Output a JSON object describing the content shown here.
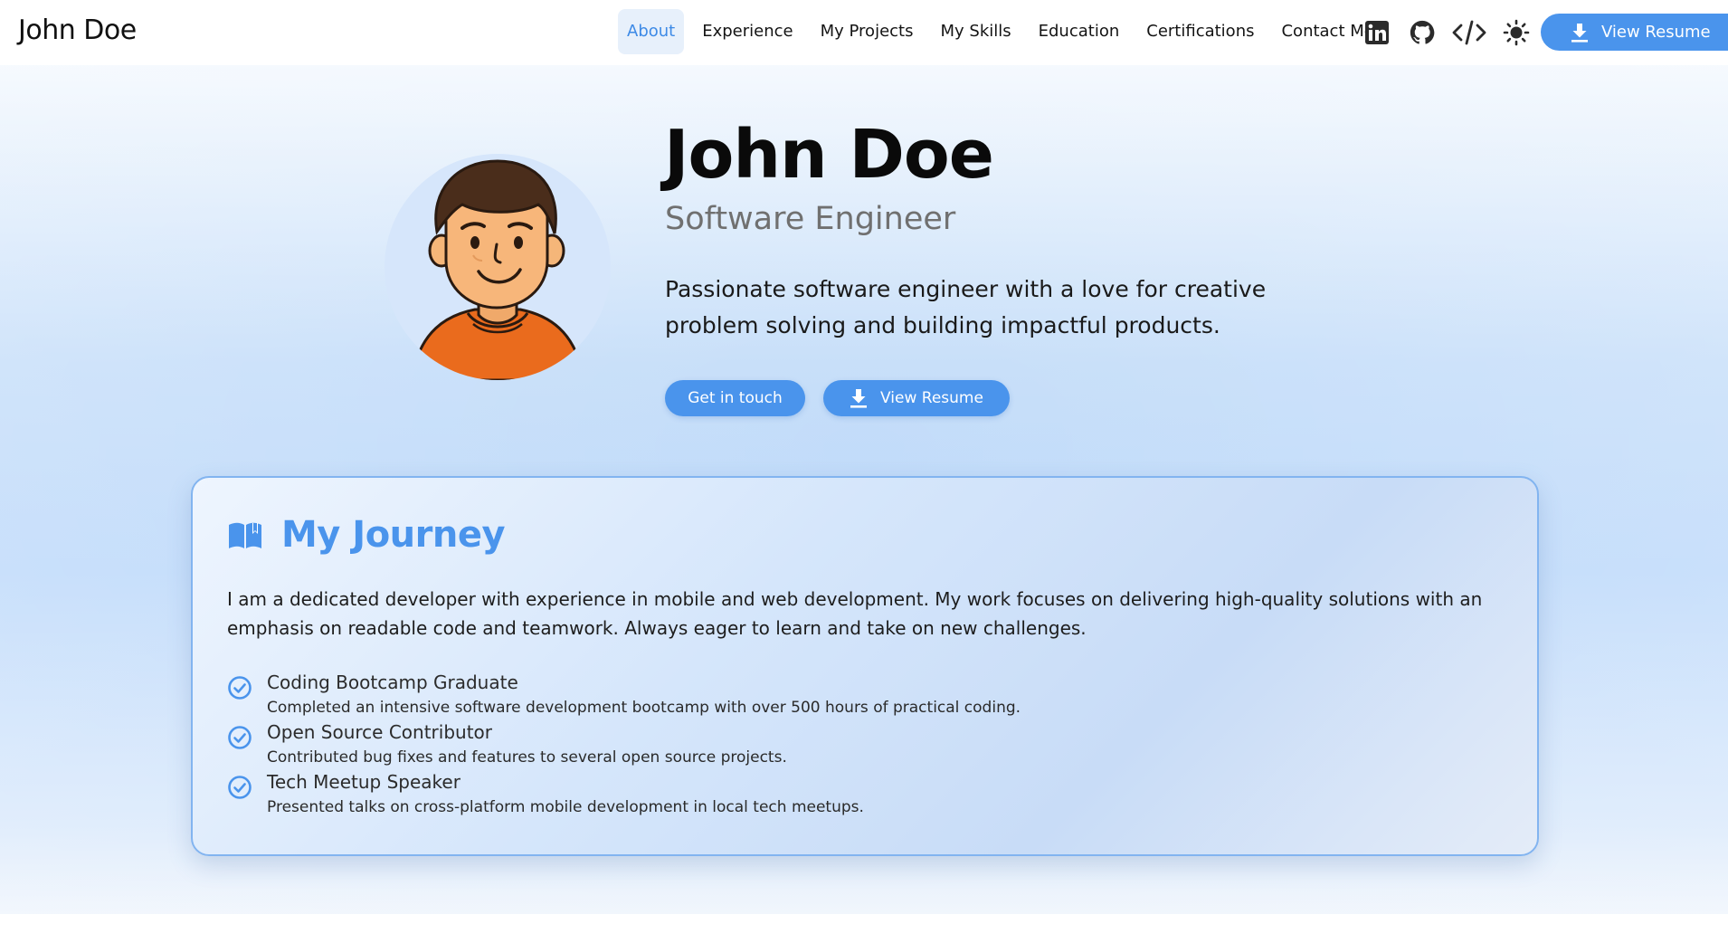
{
  "header": {
    "brand": "John Doe",
    "nav": [
      {
        "label": "About",
        "active": true
      },
      {
        "label": "Experience"
      },
      {
        "label": "My Projects"
      },
      {
        "label": "My Skills"
      },
      {
        "label": "Education"
      },
      {
        "label": "Certifications"
      },
      {
        "label": "Contact Me"
      }
    ],
    "icons": [
      "linkedin-icon",
      "github-icon",
      "code-icon",
      "theme-toggle-sun-icon"
    ],
    "resume_label": "View Resume"
  },
  "hero": {
    "name": "John Doe",
    "role": "Software Engineer",
    "description": "Passionate software engineer with a love for creative problem solving and building impactful products.",
    "cta_primary": "Get in touch",
    "cta_resume": "View Resume",
    "avatar_icon": "cartoon-avatar"
  },
  "journey": {
    "title": "My Journey",
    "title_icon": "open-book-icon",
    "intro": "I am a dedicated developer with experience in mobile and web development. My work focuses on delivering high-quality solutions with an emphasis on readable code and teamwork. Always eager to learn and take on new challenges.",
    "items": [
      {
        "title": "Coding Bootcamp Graduate",
        "detail": "Completed an intensive software development bootcamp with over 500 hours of practical coding.",
        "icon": "check-circle-icon"
      },
      {
        "title": "Open Source Contributor",
        "detail": "Contributed bug fixes and features to several open source projects.",
        "icon": "check-circle-icon"
      },
      {
        "title": "Tech Meetup Speaker",
        "detail": "Presented talks on cross-platform mobile development in local tech meetups.",
        "icon": "check-circle-icon"
      }
    ]
  },
  "colors": {
    "accent": "#4a94ec",
    "nav_active_bg": "#e7f0fb",
    "card_border": "#82b4f0",
    "hero_gradient_mid": "#c6def9"
  }
}
